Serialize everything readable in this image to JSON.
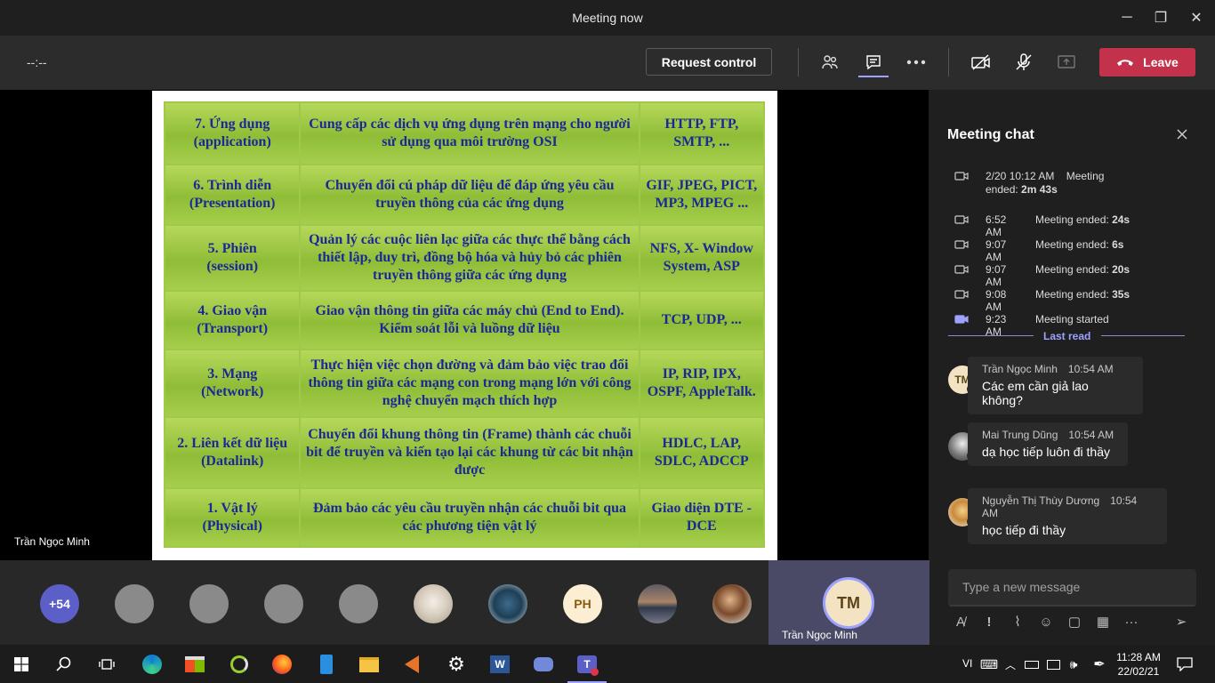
{
  "window": {
    "title": "Meeting now",
    "minimize": "─",
    "maximize": "❐",
    "close": "✕"
  },
  "toolbar": {
    "timer": "--:--",
    "request_control": "Request control",
    "leave": "Leave"
  },
  "stage": {
    "presenter_name": "Trần Ngọc Minh"
  },
  "slide": {
    "rows": [
      {
        "layer": "7. Ứng dụng\n(application)",
        "desc": "Cung cấp các dịch vụ ứng dụng trên mạng cho người sử dụng qua môi trường OSI",
        "protocols": "HTTP, FTP, SMTP, ..."
      },
      {
        "layer": "6. Trình diễn\n(Presentation)",
        "desc": "Chuyển đổi cú pháp dữ liệu để đáp ứng yêu cầu truyền thông của các ứng dụng",
        "protocols": "GIF, JPEG, PICT, MP3, MPEG ..."
      },
      {
        "layer": "5. Phiên\n(session)",
        "desc": "Quản lý các cuộc liên lạc giữa các thực thể bằng cách thiết lập, duy trì, đồng bộ hóa và hủy bỏ các phiên truyền thông giữa các ứng dụng",
        "protocols": "NFS, X- Window System, ASP"
      },
      {
        "layer": "4. Giao vận\n(Transport)",
        "desc": "Giao vận thông tin giữa các máy chủ (End to End). Kiểm soát lỗi và luồng dữ liệu",
        "protocols": "TCP, UDP, ..."
      },
      {
        "layer": "3. Mạng\n(Network)",
        "desc": "Thực hiện việc chọn đường và đảm bảo việc trao đổi thông tin giữa các mạng con trong mạng lớn với công nghệ chuyển mạch thích hợp",
        "protocols": "IP, RIP, IPX, OSPF, AppleTalk."
      },
      {
        "layer": "2. Liên kết dữ liệu\n(Datalink)",
        "desc": "Chuyển đổi khung thông tin (Frame) thành các chuỗi bit để truyền và kiến tạo lại các khung từ các bit nhận được",
        "protocols": "HDLC, LAP, SDLC, ADCCP"
      },
      {
        "layer": "1. Vật lý\n(Physical)",
        "desc": "Đảm bảo các yêu cầu truyền nhận các chuỗi bit qua các phương tiện vật lý",
        "protocols": "Giao diện DTE - DCE"
      }
    ]
  },
  "participants": {
    "overflow": "+54",
    "ph_initials": "PH",
    "self_initials": "TM",
    "self_name": "Trần Ngọc Minh"
  },
  "chat": {
    "title": "Meeting chat",
    "events": [
      {
        "time": "2/20 10:12 AM",
        "text": "Meeting ended:",
        "duration": "2m 43s"
      },
      {
        "time": "6:52 AM",
        "text": "Meeting ended:",
        "duration": "24s"
      },
      {
        "time": "9:07 AM",
        "text": "Meeting ended:",
        "duration": "6s"
      },
      {
        "time": "9:07 AM",
        "text": "Meeting ended:",
        "duration": "20s"
      },
      {
        "time": "9:08 AM",
        "text": "Meeting ended:",
        "duration": "35s"
      },
      {
        "time": "9:23 AM",
        "text": "Meeting started",
        "duration": ""
      }
    ],
    "last_read": "Last read",
    "messages": [
      {
        "initials": "TM",
        "author": "Trần Ngọc Minh",
        "time": "10:54 AM",
        "body": "Các em cần giả lao không?"
      },
      {
        "initials": "",
        "author": "Mai Trung Dũng",
        "time": "10:54 AM",
        "body": "dạ học tiếp luôn đi thầy"
      },
      {
        "initials": "",
        "author": "Nguyễn Thị Thùy Dương",
        "time": "10:54 AM",
        "body": "học tiếp đi thầy"
      }
    ],
    "compose_placeholder": "Type a new message"
  },
  "taskbar": {
    "language": "VI",
    "time": "11:28 AM",
    "date": "22/02/21"
  },
  "colors": {
    "accent": "#6264a7",
    "leave": "#c4314b",
    "slide_green": "#9fc94a",
    "slide_text": "#1b2896"
  }
}
